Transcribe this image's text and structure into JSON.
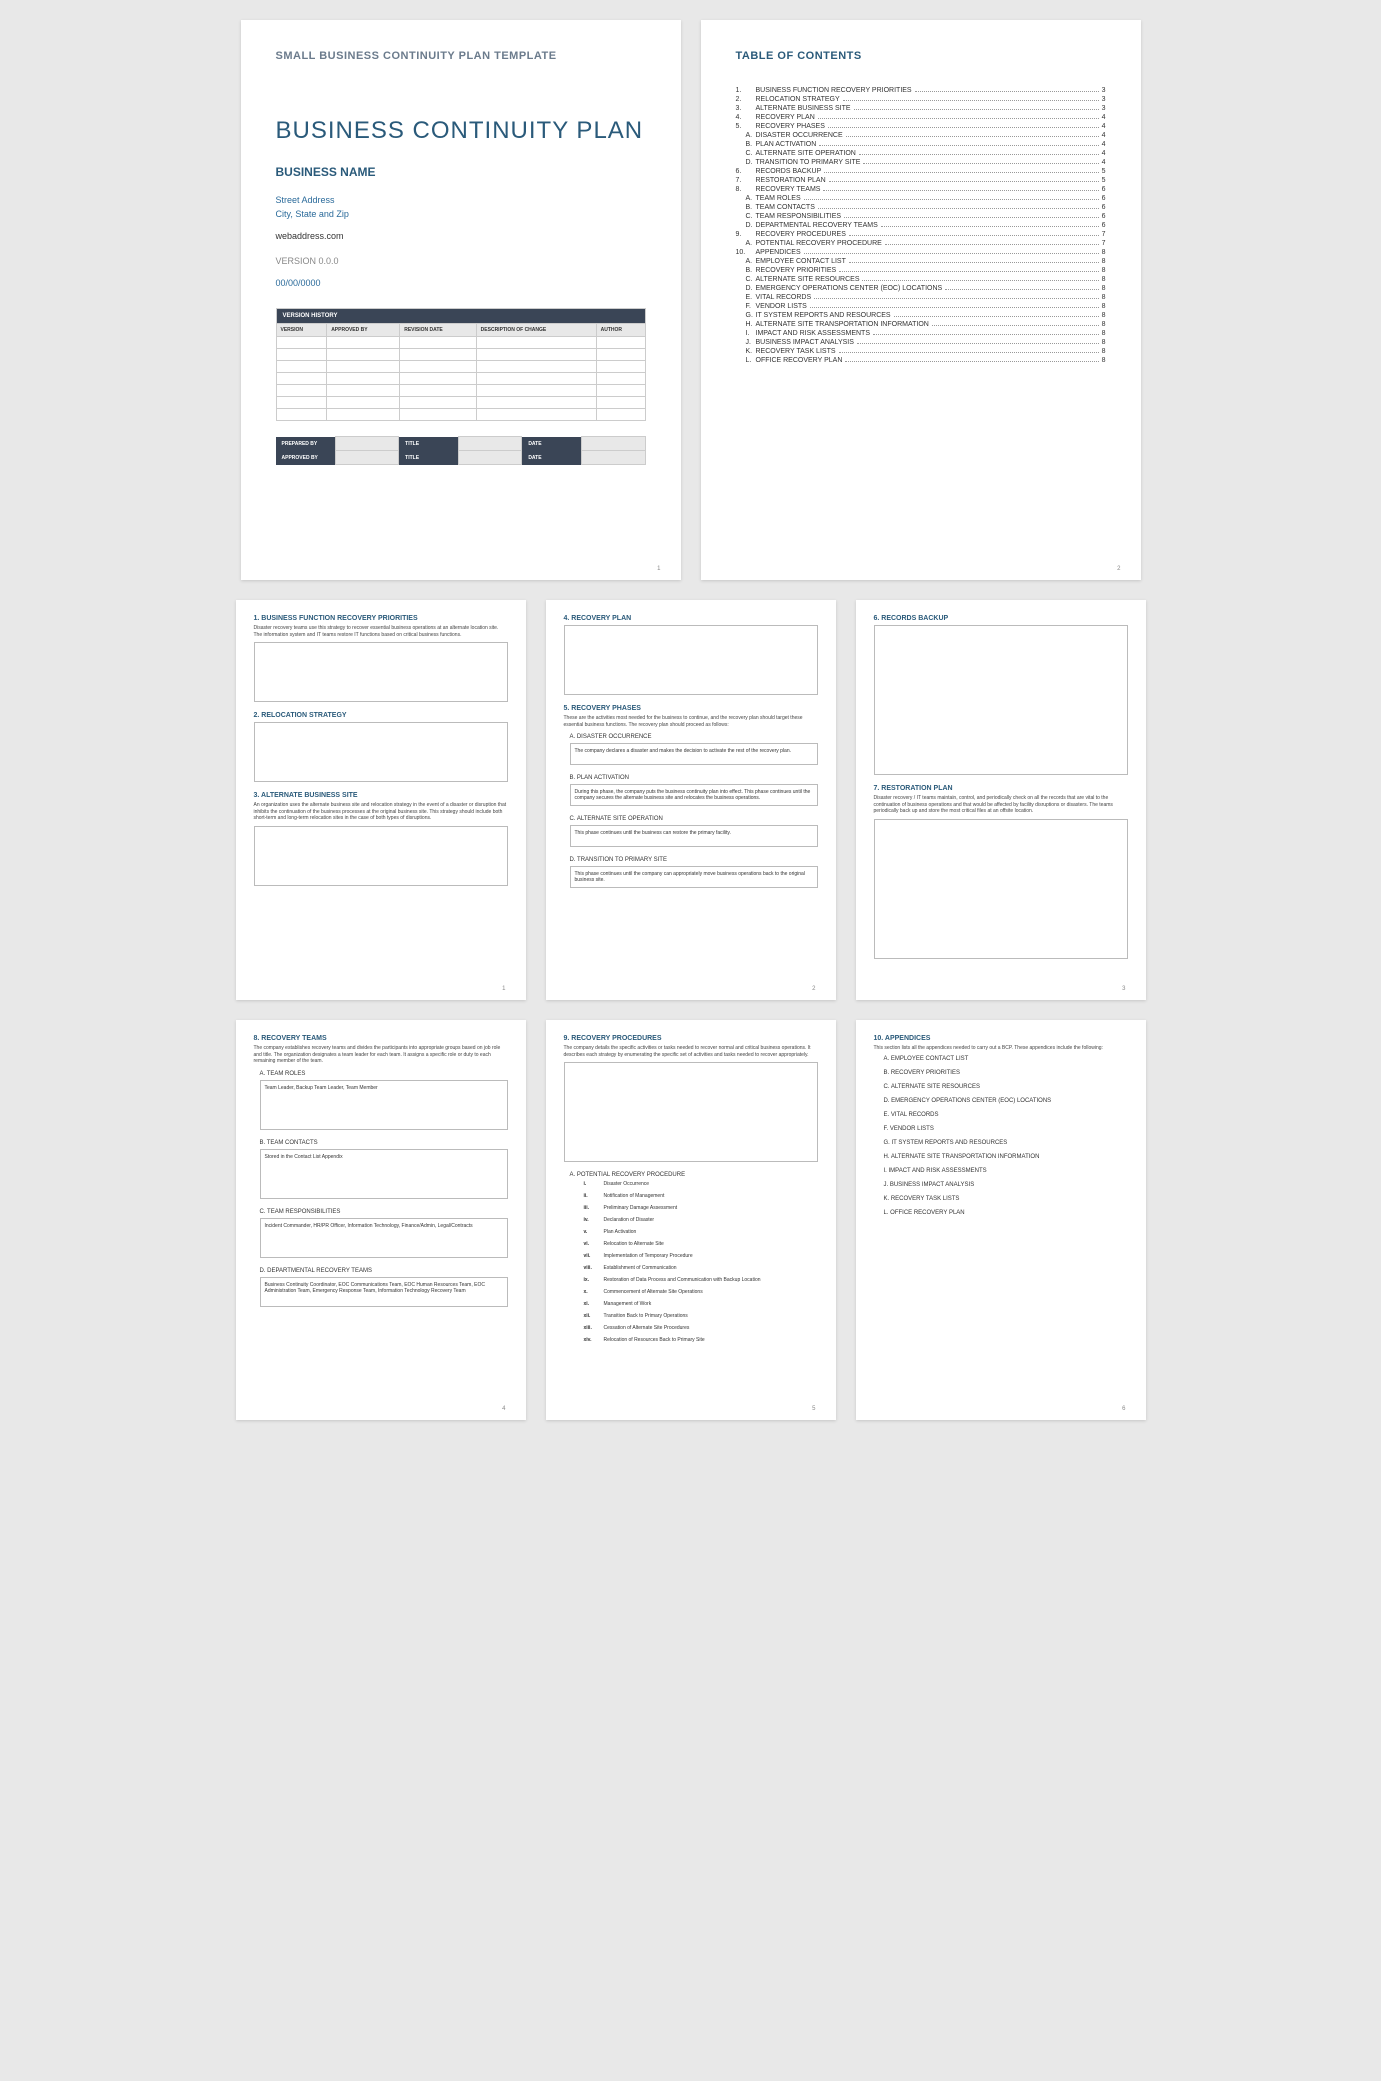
{
  "page1": {
    "template_title": "SMALL BUSINESS CONTINUITY PLAN TEMPLATE",
    "doc_title": "BUSINESS CONTINUITY PLAN",
    "business_name": "BUSINESS NAME",
    "street": "Street Address",
    "city": "City, State and Zip",
    "web": "webaddress.com",
    "version": "VERSION 0.0.0",
    "date": "00/00/0000",
    "vh_header": "VERSION HISTORY",
    "vh_cols": [
      "VERSION",
      "APPROVED BY",
      "REVISION DATE",
      "DESCRIPTION OF CHANGE",
      "AUTHOR"
    ],
    "sig": {
      "prepared": "PREPARED BY",
      "approved": "APPROVED BY",
      "title": "TITLE",
      "date": "DATE"
    },
    "pnum": "1"
  },
  "page2": {
    "title": "TABLE OF CONTENTS",
    "items": [
      {
        "n": "1.",
        "t": "BUSINESS FUNCTION RECOVERY PRIORITIES",
        "p": "3"
      },
      {
        "n": "2.",
        "t": "RELOCATION STRATEGY",
        "p": "3"
      },
      {
        "n": "3.",
        "t": "ALTERNATE BUSINESS SITE",
        "p": "3"
      },
      {
        "n": "4.",
        "t": "RECOVERY PLAN",
        "p": "4"
      },
      {
        "n": "5.",
        "t": "RECOVERY PHASES",
        "p": "4"
      },
      {
        "n": "A.",
        "t": "DISASTER OCCURRENCE",
        "p": "4",
        "sub": true
      },
      {
        "n": "B.",
        "t": "PLAN ACTIVATION",
        "p": "4",
        "sub": true
      },
      {
        "n": "C.",
        "t": "ALTERNATE SITE OPERATION",
        "p": "4",
        "sub": true
      },
      {
        "n": "D.",
        "t": "TRANSITION TO PRIMARY SITE",
        "p": "4",
        "sub": true
      },
      {
        "n": "6.",
        "t": "RECORDS BACKUP",
        "p": "5"
      },
      {
        "n": "7.",
        "t": "RESTORATION PLAN",
        "p": "5"
      },
      {
        "n": "8.",
        "t": "RECOVERY TEAMS",
        "p": "6"
      },
      {
        "n": "A.",
        "t": "TEAM ROLES",
        "p": "6",
        "sub": true
      },
      {
        "n": "B.",
        "t": "TEAM CONTACTS",
        "p": "6",
        "sub": true
      },
      {
        "n": "C.",
        "t": "TEAM RESPONSIBILITIES",
        "p": "6",
        "sub": true
      },
      {
        "n": "D.",
        "t": "DEPARTMENTAL RECOVERY TEAMS",
        "p": "6",
        "sub": true
      },
      {
        "n": "9.",
        "t": "RECOVERY PROCEDURES",
        "p": "7"
      },
      {
        "n": "A.",
        "t": "POTENTIAL RECOVERY PROCEDURE",
        "p": "7",
        "sub": true
      },
      {
        "n": "10.",
        "t": "APPENDICES",
        "p": "8"
      },
      {
        "n": "A.",
        "t": "EMPLOYEE CONTACT LIST",
        "p": "8",
        "sub": true
      },
      {
        "n": "B.",
        "t": "RECOVERY PRIORITIES",
        "p": "8",
        "sub": true
      },
      {
        "n": "C.",
        "t": "ALTERNATE SITE RESOURCES",
        "p": "8",
        "sub": true
      },
      {
        "n": "D.",
        "t": "EMERGENCY OPERATIONS CENTER (EOC) LOCATIONS",
        "p": "8",
        "sub": true
      },
      {
        "n": "E.",
        "t": "VITAL RECORDS",
        "p": "8",
        "sub": true
      },
      {
        "n": "F.",
        "t": "VENDOR LISTS",
        "p": "8",
        "sub": true
      },
      {
        "n": "G.",
        "t": "IT SYSTEM REPORTS AND RESOURCES",
        "p": "8",
        "sub": true
      },
      {
        "n": "H.",
        "t": "ALTERNATE SITE TRANSPORTATION INFORMATION",
        "p": "8",
        "sub": true
      },
      {
        "n": "I.",
        "t": "IMPACT AND RISK ASSESSMENTS",
        "p": "8",
        "sub": true
      },
      {
        "n": "J.",
        "t": "BUSINESS IMPACT ANALYSIS",
        "p": "8",
        "sub": true
      },
      {
        "n": "K.",
        "t": "RECOVERY TASK LISTS",
        "p": "8",
        "sub": true
      },
      {
        "n": "L.",
        "t": "OFFICE RECOVERY PLAN",
        "p": "8",
        "sub": true
      }
    ],
    "pnum": "2"
  },
  "page3": {
    "s1_h": "1. BUSINESS FUNCTION RECOVERY PRIORITIES",
    "s1_p": "Disaster recovery teams use this strategy to recover essential business operations at an alternate location site. The information system and IT teams restore IT functions based on critical business functions.",
    "s2_h": "2. RELOCATION STRATEGY",
    "s3_h": "3. ALTERNATE BUSINESS SITE",
    "s3_p": "An organization uses the alternate business site and relocation strategy in the event of a disaster or disruption that inhibits the continuation of the business processes at the original business site. This strategy should include both short-term and long-term relocation sites in the case of both types of disruptions.",
    "pnum": "1"
  },
  "page4": {
    "s4_h": "4. RECOVERY PLAN",
    "s5_h": "5. RECOVERY PHASES",
    "s5_p": "These are the activities most needed for the business to continue, and the recovery plan should target these essential business functions. The recovery plan should proceed as follows:",
    "a_h": "A. DISASTER OCCURRENCE",
    "a_t": "The company declares a disaster and makes the decision to activate the rest of the recovery plan.",
    "b_h": "B. PLAN ACTIVATION",
    "b_t": "During this phase, the company puts the business continuity plan into effect. This phase continues until the company secures the alternate business site and relocates the business operations.",
    "c_h": "C. ALTERNATE SITE OPERATION",
    "c_t": "This phase continues until the business can restore the primary facility.",
    "d_h": "D. TRANSITION TO PRIMARY SITE",
    "d_t": "This phase continues until the company can appropriately move business operations back to the original business site.",
    "pnum": "2"
  },
  "page5": {
    "s6_h": "6. RECORDS BACKUP",
    "s7_h": "7. RESTORATION PLAN",
    "s7_p": "Disaster recovery / IT teams maintain, control, and periodically check on all the records that are vital to the continuation of business operations and that would be affected by facility disruptions or disasters. The teams periodically back up and store the most critical files at an offsite location.",
    "pnum": "3"
  },
  "page6": {
    "s8_h": "8. RECOVERY TEAMS",
    "s8_p": "The company establishes recovery teams and divides the participants into appropriate groups based on job role and title. The organization designates a team leader for each team. It assigns a specific role or duty to each remaining member of the team.",
    "a_h": "A. TEAM ROLES",
    "a_t": "Team Leader, Backup Team Leader, Team Member",
    "b_h": "B. TEAM CONTACTS",
    "b_t": "Stored in the Contact List Appendix",
    "c_h": "C. TEAM RESPONSIBILITIES",
    "c_t": "Incident Commander, HR/PR Officer, Information Technology, Finance/Admin, Legal/Contracts",
    "d_h": "D. DEPARTMENTAL RECOVERY TEAMS",
    "d_t": "Business Continuity Coordinator, EOC Communications Team, EOC Human Resources Team, EOC Administration Team, Emergency Response Team, Information Technology Recovery Team",
    "pnum": "4"
  },
  "page7": {
    "s9_h": "9. RECOVERY PROCEDURES",
    "s9_p": "The company details the specific activities or tasks needed to recover normal and critical business operations. It describes each strategy by enumerating the specific set of activities and tasks needed to recover appropriately.",
    "a_h": "A. POTENTIAL RECOVERY PROCEDURE",
    "steps": [
      "Disaster Occurrence",
      "Notification of Management",
      "Preliminary Damage Assessment",
      "Declaration of Disaster",
      "Plan Activation",
      "Relocation to Alternate Site",
      "Implementation of Temporary Procedure",
      "Establishment of Communication",
      "Restoration of Data Process and Communication with Backup Location",
      "Commencement of Alternate Site Operations",
      "Management of Work",
      "Transition Back to Primary Operations",
      "Cessation of Alternate Site Procedures",
      "Relocation of Resources Back to Primary Site"
    ],
    "roman": [
      "i.",
      "ii.",
      "iii.",
      "iv.",
      "v.",
      "vi.",
      "vii.",
      "viii.",
      "ix.",
      "x.",
      "xi.",
      "xii.",
      "xiii.",
      "xiv."
    ],
    "pnum": "5"
  },
  "page8": {
    "s10_h": "10.   APPENDICES",
    "s10_p": "This section lists all the appendices needed to carry out a BCP. These appendices include the following:",
    "items": [
      {
        "n": "A.",
        "t": "EMPLOYEE CONTACT LIST"
      },
      {
        "n": "B.",
        "t": "RECOVERY PRIORITIES"
      },
      {
        "n": "C.",
        "t": "ALTERNATE SITE RESOURCES"
      },
      {
        "n": "D.",
        "t": "EMERGENCY OPERATIONS CENTER (EOC) LOCATIONS"
      },
      {
        "n": "E.",
        "t": "VITAL RECORDS"
      },
      {
        "n": "F.",
        "t": "VENDOR LISTS"
      },
      {
        "n": "G.",
        "t": "IT SYSTEM REPORTS AND RESOURCES"
      },
      {
        "n": "H.",
        "t": "ALTERNATE SITE TRANSPORTATION INFORMATION"
      },
      {
        "n": "I.",
        "t": "IMPACT AND RISK ASSESSMENTS"
      },
      {
        "n": "J.",
        "t": "BUSINESS IMPACT ANALYSIS"
      },
      {
        "n": "K.",
        "t": "RECOVERY TASK LISTS"
      },
      {
        "n": "L.",
        "t": "OFFICE RECOVERY PLAN"
      }
    ],
    "pnum": "6"
  }
}
